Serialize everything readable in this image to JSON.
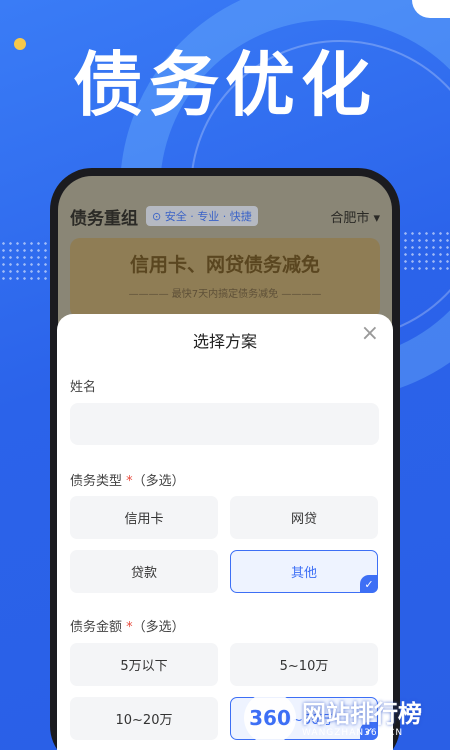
{
  "hero": {
    "title": "债务优化"
  },
  "app": {
    "title": "债务重组",
    "tag": "安全 · 专业 · 快捷",
    "city": "合肥市 ▾"
  },
  "banner": {
    "title": "信用卡、网贷债务减免",
    "subtitle": "———— 最快7天内搞定债务减免 ————"
  },
  "sheet": {
    "title": "选择方案",
    "close": "×",
    "name_label": "姓名",
    "name_value": "",
    "debt_type": {
      "label": "债务类型",
      "required": "*",
      "suffix": "（多选）",
      "options": [
        {
          "label": "信用卡",
          "selected": false
        },
        {
          "label": "网贷",
          "selected": false
        },
        {
          "label": "贷款",
          "selected": false
        },
        {
          "label": "其他",
          "selected": true
        }
      ]
    },
    "debt_amount": {
      "label": "债务金额",
      "required": "*",
      "suffix": "（多选）",
      "options": [
        {
          "label": "5万以下",
          "selected": false
        },
        {
          "label": "5~10万",
          "selected": false
        },
        {
          "label": "10~20万",
          "selected": false
        },
        {
          "label": "20~50万",
          "selected": true
        }
      ]
    }
  },
  "watermark": {
    "badge": "360",
    "text": "网站排行榜",
    "url": "WANGZHAN360.CN"
  },
  "colors": {
    "accent": "#3d6ff5",
    "required": "#e84a3c",
    "background": "#2f6df2"
  }
}
